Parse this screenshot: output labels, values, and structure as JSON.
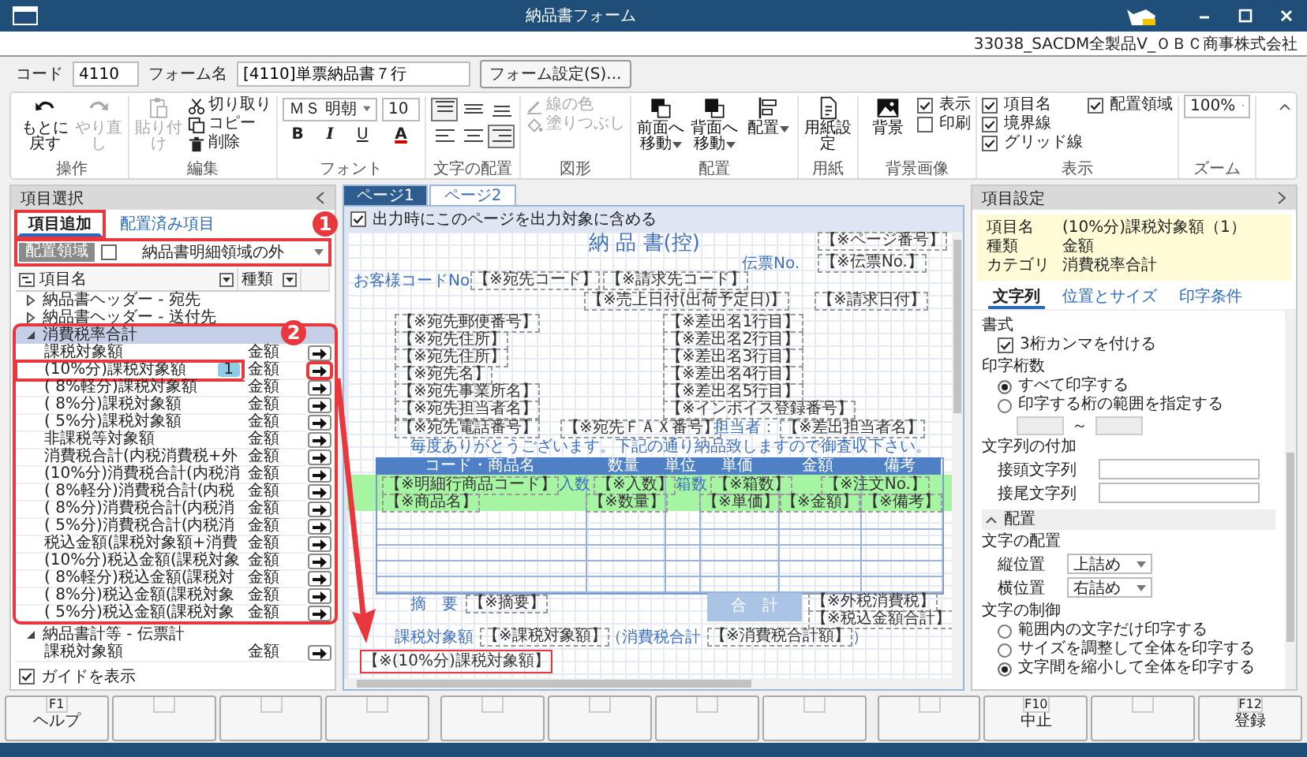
{
  "window": {
    "title": "納品書フォーム",
    "company": "33038_SACDM全製品V_ＯＢＣ商事株式会社"
  },
  "header": {
    "code_label": "コード",
    "code": "4110",
    "form_label": "フォーム名",
    "form_name": "[4110]単票納品書７行",
    "settings_button": "フォーム設定(S)..."
  },
  "ribbon": {
    "groups": [
      {
        "label": "操作",
        "items": [
          {
            "kind": "undo",
            "label": "もとに戻す",
            "disabled": false
          },
          {
            "kind": "redo",
            "label": "やり直し",
            "disabled": true
          }
        ]
      },
      {
        "label": "編集",
        "items": [
          {
            "kind": "paste",
            "label": "貼り付け",
            "disabled": true
          },
          {
            "kind": "cut",
            "label": "切り取り",
            "disabled": false
          },
          {
            "kind": "copy",
            "label": "コピー",
            "disabled": false
          },
          {
            "kind": "delete",
            "label": "削除",
            "disabled": false
          }
        ]
      },
      {
        "label": "フォント",
        "items": [
          {
            "kind": "font-select",
            "value": "ＭＳ 明朝"
          },
          {
            "kind": "size-field",
            "value": "10"
          },
          {
            "kind": "bold",
            "label": "B"
          },
          {
            "kind": "italic",
            "label": "I"
          },
          {
            "kind": "underline",
            "label": "U"
          },
          {
            "kind": "font-color",
            "label": "A"
          }
        ]
      },
      {
        "label": "文字の配置",
        "items": [
          {
            "kind": "valign-top",
            "selected": true
          },
          {
            "kind": "valign-middle",
            "selected": false
          },
          {
            "kind": "valign-bottom",
            "selected": false
          },
          {
            "kind": "align-left",
            "selected": false
          },
          {
            "kind": "align-center",
            "selected": false
          },
          {
            "kind": "align-right",
            "selected": true
          }
        ]
      },
      {
        "label": "図形",
        "items": [
          {
            "kind": "line-color",
            "label": "線の色",
            "disabled": true
          },
          {
            "kind": "fill",
            "label": "塗りつぶし",
            "disabled": true
          }
        ]
      },
      {
        "label": "配置",
        "items": [
          {
            "kind": "front",
            "label": "前面へ移動",
            "disabled": false
          },
          {
            "kind": "back",
            "label": "背面へ移動",
            "disabled": false
          },
          {
            "kind": "arrange",
            "label": "配置",
            "disabled": false
          }
        ]
      },
      {
        "label": "用紙",
        "items": [
          {
            "kind": "paper",
            "label": "用紙設定",
            "disabled": false
          }
        ]
      },
      {
        "label": "背景画像",
        "items": [
          {
            "kind": "background",
            "label": "背景",
            "disabled": false
          },
          {
            "kind": "checkbox",
            "label": "表示",
            "checked": true
          },
          {
            "kind": "checkbox",
            "label": "印刷",
            "checked": false
          }
        ]
      },
      {
        "label": "表示",
        "items": [
          {
            "kind": "checkbox",
            "label": "項目名",
            "checked": true
          },
          {
            "kind": "checkbox",
            "label": "境界線",
            "checked": true
          },
          {
            "kind": "checkbox",
            "label": "グリッド線",
            "checked": true
          },
          {
            "kind": "checkbox",
            "label": "配置領域",
            "checked": true
          }
        ]
      },
      {
        "label": "ズーム",
        "items": [
          {
            "kind": "zoom-select",
            "value": "100%"
          }
        ]
      }
    ]
  },
  "left": {
    "title": "項目選択",
    "tabs": [
      {
        "label": "項目追加",
        "selected": true,
        "outlined": true
      },
      {
        "label": "配置済み項目",
        "selected": false,
        "outlined": false
      }
    ],
    "area": {
      "badge": "配置領域",
      "checked": false,
      "value": "納品書明細領域の外",
      "outlined": true
    },
    "columns": [
      "項目名",
      "種類"
    ],
    "tree": [
      {
        "name": "納品書ヘッダー - 宛先",
        "expanded": false,
        "selected": false,
        "outlined": false
      },
      {
        "name": "納品書ヘッダー - 送付先",
        "expanded": false,
        "selected": false,
        "outlined": false
      },
      {
        "name": "消費税率合計",
        "expanded": true,
        "selected": true,
        "outlined": true,
        "children": [
          {
            "name": "課税対象額",
            "type": "金額",
            "outlined": false
          },
          {
            "name": "(10%分)課税対象額",
            "type": "金額",
            "count": "1",
            "outlined": true
          },
          {
            "name": "( 8%軽分)課税対象額",
            "type": "金額",
            "outlined": false
          },
          {
            "name": "( 8%分)課税対象額",
            "type": "金額",
            "outlined": false
          },
          {
            "name": "( 5%分)課税対象額",
            "type": "金額",
            "outlined": false
          },
          {
            "name": "非課税等対象額",
            "type": "金額",
            "outlined": false
          },
          {
            "name": "消費税合計(内税消費税+外",
            "type": "金額",
            "outlined": false
          },
          {
            "name": "(10%分)消費税合計(内税消",
            "type": "金額",
            "outlined": false
          },
          {
            "name": "( 8%軽分)消費税合計(内税",
            "type": "金額",
            "outlined": false
          },
          {
            "name": "( 8%分)消費税合計(内税消",
            "type": "金額",
            "outlined": false
          },
          {
            "name": "( 5%分)消費税合計(内税消",
            "type": "金額",
            "outlined": false
          },
          {
            "name": "税込金額(課税対象額+消費",
            "type": "金額",
            "outlined": false
          },
          {
            "name": "(10%分)税込金額(課税対象",
            "type": "金額",
            "outlined": false
          },
          {
            "name": "( 8%軽分)税込金額(課税対",
            "type": "金額",
            "outlined": false
          },
          {
            "name": "( 8%分)税込金額(課税対象",
            "type": "金額",
            "outlined": false
          },
          {
            "name": "( 5%分)税込金額(課税対象",
            "type": "金額",
            "outlined": false
          }
        ]
      },
      {
        "name": "納品書計等 - 伝票計",
        "expanded": true,
        "selected": false,
        "outlined": false,
        "children": [
          {
            "name": "課税対象額",
            "type": "金額",
            "outlined": false
          }
        ]
      }
    ],
    "guide": {
      "label": "ガイドを表示",
      "checked": true
    }
  },
  "annotations": [
    {
      "number": "1"
    },
    {
      "number": "2"
    }
  ],
  "center": {
    "tabs": [
      {
        "label": "ページ1",
        "selected": true
      },
      {
        "label": "ページ2",
        "selected": false
      }
    ],
    "include": {
      "label": "出力時にこのページを出力対象に含める",
      "checked": true
    },
    "columns": [
      "コード・商品名",
      "数量",
      "単位",
      "単価",
      "金額",
      "備考"
    ],
    "items": [
      {
        "kind": "title",
        "text": "納 品 書(控)"
      },
      {
        "kind": "field",
        "text": "【※ページ番号】",
        "selected": false
      },
      {
        "kind": "label",
        "text": "伝票No."
      },
      {
        "kind": "field",
        "text": "【※伝票No.】",
        "selected": false
      },
      {
        "kind": "label",
        "text": "お客様コードNo"
      },
      {
        "kind": "field",
        "text": "【※宛先コード】",
        "selected": false
      },
      {
        "kind": "field",
        "text": "【※請求先コード】",
        "selected": false
      },
      {
        "kind": "field",
        "text": "【※売上日付(出荷予定日)】",
        "selected": false
      },
      {
        "kind": "field",
        "text": "【※請求日付】",
        "selected": false
      },
      {
        "kind": "field",
        "text": "【※宛先郵便番号】",
        "selected": false
      },
      {
        "kind": "field",
        "text": "【※宛先住所】",
        "selected": false
      },
      {
        "kind": "field",
        "text": "【※宛先住所】",
        "selected": false
      },
      {
        "kind": "field",
        "text": "【※宛先名】",
        "selected": false
      },
      {
        "kind": "field",
        "text": "【※宛先事業所名】",
        "selected": false
      },
      {
        "kind": "field",
        "text": "【※宛先担当者名】",
        "selected": false
      },
      {
        "kind": "field",
        "text": "【※宛先電話番号】",
        "selected": false
      },
      {
        "kind": "field",
        "text": "【※宛先ＦＡＸ番号】",
        "selected": false
      },
      {
        "kind": "field",
        "text": "【※差出名1行目】",
        "selected": false
      },
      {
        "kind": "field",
        "text": "【※差出名2行目】",
        "selected": false
      },
      {
        "kind": "field",
        "text": "【※差出名3行目】",
        "selected": false
      },
      {
        "kind": "field",
        "text": "【※差出名4行目】",
        "selected": false
      },
      {
        "kind": "field",
        "text": "【※差出名5行目】",
        "selected": false
      },
      {
        "kind": "field",
        "text": "【※インボイス登録番号】",
        "selected": false
      },
      {
        "kind": "label",
        "text": "担当者："
      },
      {
        "kind": "field",
        "text": "【※差出担当者名】",
        "selected": false
      },
      {
        "kind": "label",
        "text": "毎度ありがとうございます。下記の通り納品致しますので御査収下さい。"
      },
      {
        "kind": "field",
        "text": "【※明細行商品コード】",
        "selected": false
      },
      {
        "kind": "label",
        "text": "入数"
      },
      {
        "kind": "field",
        "text": "【※入数】",
        "selected": false
      },
      {
        "kind": "label",
        "text": "箱数"
      },
      {
        "kind": "field",
        "text": "【※箱数】",
        "selected": false
      },
      {
        "kind": "field",
        "text": "【※注文No.】",
        "selected": false
      },
      {
        "kind": "field",
        "text": "【※商品名】",
        "selected": false
      },
      {
        "kind": "field",
        "text": "【※数量】",
        "selected": false
      },
      {
        "kind": "field",
        "text": "【※単価】",
        "selected": false
      },
      {
        "kind": "field",
        "text": "【※金額】",
        "selected": false
      },
      {
        "kind": "field",
        "text": "【※備考】",
        "selected": false
      },
      {
        "kind": "label",
        "text": "摘　要"
      },
      {
        "kind": "field",
        "text": "【※摘要】",
        "selected": false
      },
      {
        "kind": "total",
        "text": "合　計"
      },
      {
        "kind": "field",
        "text": "【※外税消費税】",
        "selected": false
      },
      {
        "kind": "field",
        "text": "【※税込金額合計】",
        "selected": false
      },
      {
        "kind": "label",
        "text": "課税対象額"
      },
      {
        "kind": "field",
        "text": "【※課税対象額】",
        "selected": false
      },
      {
        "kind": "label",
        "text": "（消費税合計"
      },
      {
        "kind": "field",
        "text": "【※消費税合計額】",
        "selected": false
      },
      {
        "kind": "label",
        "text": "）"
      },
      {
        "kind": "field",
        "text": "【※(10%分)課税対象額】",
        "selected": true
      }
    ]
  },
  "properties": {
    "title": "項目設定",
    "info": [
      {
        "label": "項目名",
        "value": "(10%分)課税対象額（1）"
      },
      {
        "label": "種類",
        "value": "金額"
      },
      {
        "label": "カテゴリ",
        "value": "消費税率合計"
      }
    ],
    "tabs": [
      {
        "label": "文字列",
        "selected": true
      },
      {
        "label": "位置とサイズ",
        "selected": false
      },
      {
        "label": "印字条件",
        "selected": false
      }
    ],
    "format": {
      "heading": "書式",
      "label": "3桁カンマを付ける",
      "checked": true
    },
    "digits": {
      "heading": "印字桁数",
      "options": [
        {
          "label": "すべて印字する",
          "selected": true
        },
        {
          "label": "印字する桁の範囲を指定する",
          "selected": false
        }
      ],
      "separator": "～"
    },
    "affix": {
      "heading": "文字列の付加",
      "fields": [
        {
          "label": "接頭文字列"
        },
        {
          "label": "接尾文字列"
        }
      ]
    },
    "layout": {
      "title": "配置",
      "expanded": true,
      "heading": "文字の配置",
      "selects": [
        {
          "label": "縦位置",
          "value": "上詰め"
        },
        {
          "label": "横位置",
          "value": "右詰め"
        }
      ],
      "control_heading": "文字の制御",
      "options": [
        {
          "label": "範囲内の文字だけ印字する",
          "selected": false
        },
        {
          "label": "サイズを調整して全体を印字する",
          "selected": false
        },
        {
          "label": "文字間を縮小して全体を印字する",
          "selected": true
        }
      ]
    }
  },
  "function_keys": [
    {
      "key": "F1",
      "label": "ヘルプ"
    },
    {
      "key": "F10",
      "label": "中止"
    },
    {
      "key": "F12",
      "label": "登録"
    }
  ]
}
